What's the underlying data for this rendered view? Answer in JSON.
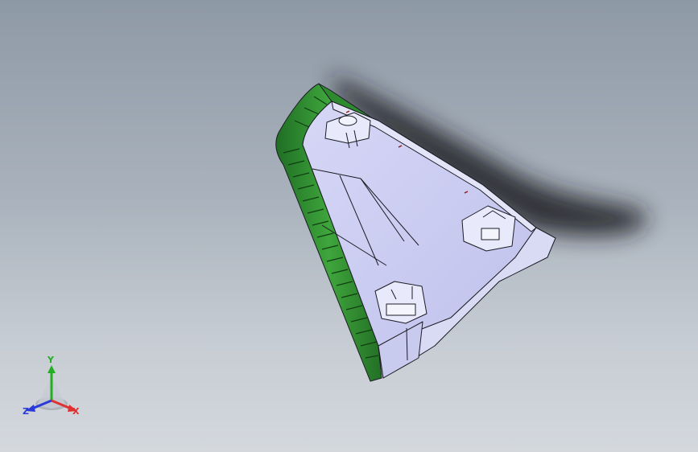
{
  "viewport": {
    "model": "triangular-trim-part",
    "colors": {
      "background_top": "#8e99a6",
      "background_bottom": "#d4d8dd",
      "body": "#c9cbf0",
      "edge_band": "#2f8a2f",
      "outline": "#1c1c24",
      "shadow": "#1a1d22"
    }
  },
  "triad": {
    "x_label": "X",
    "y_label": "Y",
    "z_label": "Z",
    "colors": {
      "x": "#e03030",
      "y": "#22b022",
      "z": "#2a3ad8"
    }
  }
}
